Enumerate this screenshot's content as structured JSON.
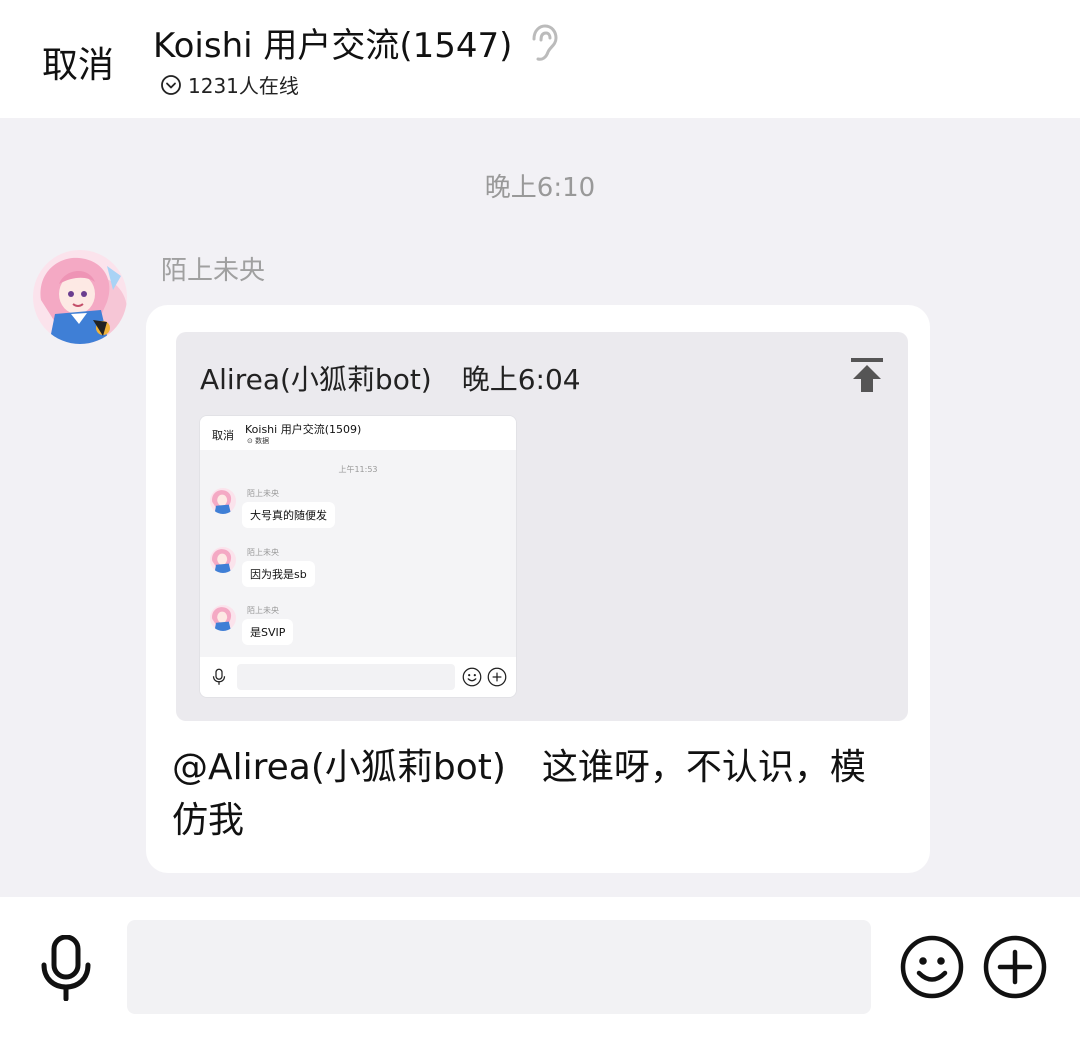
{
  "header": {
    "cancel_label": "取消",
    "title": "Koishi 用户交流(1547)",
    "online": "1231人在线"
  },
  "chat": {
    "timestamp": "晚上6:10",
    "message": {
      "sender": "陌上未央",
      "quote": {
        "author": "Alirea(小狐莉bot)",
        "time": "晚上6:04",
        "screenshot": {
          "cancel_label": "取消",
          "title": "Koishi 用户交流(1509)",
          "online": "数据",
          "timestamp": "上午11:53",
          "messages": [
            {
              "sender": "陌上未央",
              "text": "大号真的随便发"
            },
            {
              "sender": "陌上未央",
              "text": "因为我是sb"
            },
            {
              "sender": "陌上未央",
              "text": "是SVIP"
            }
          ]
        }
      },
      "text": "@Alirea(小狐莉bot)　这谁呀，不认识，模仿我"
    }
  },
  "input_bar": {
    "placeholder": ""
  },
  "icons": [
    "ear-icon",
    "chevron-down-circle-icon",
    "jump-to-top-icon",
    "microphone-icon",
    "emoji-icon",
    "plus-circle-icon"
  ],
  "colors": {
    "background": "#f2f1f5",
    "bubble": "#ffffff",
    "quote_bg": "#ebeaee",
    "muted_text": "#999999"
  }
}
